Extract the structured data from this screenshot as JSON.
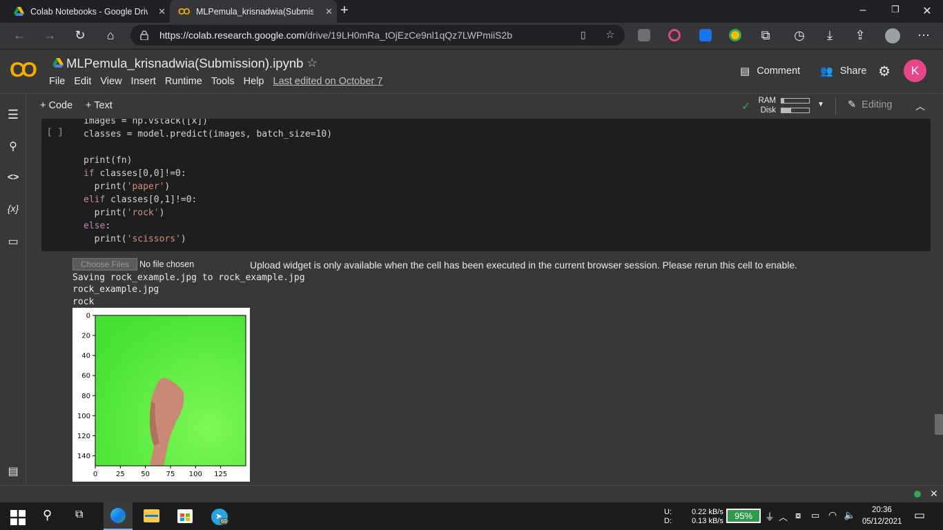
{
  "browser": {
    "tabs": [
      {
        "title": "Colab Notebooks - Google Drive"
      },
      {
        "title": "MLPemula_krisnadwia(Submission)"
      }
    ],
    "url_host": "https://colab.research.google.com",
    "url_path": "/drive/19LH0mRa_tOjEzCe9nl1qQz7LWPmiiS2b"
  },
  "colab": {
    "logo": "CO",
    "title": "MLPemula_krisnadwia(Submission).ipynb",
    "menu": [
      "File",
      "Edit",
      "View",
      "Insert",
      "Runtime",
      "Tools",
      "Help"
    ],
    "last_edited": "Last edited on October 7",
    "comment": "Comment",
    "share": "Share",
    "avatar": "K",
    "add_code": "+ Code",
    "add_text": "+ Text",
    "ram": "RAM",
    "disk": "Disk",
    "editing": "Editing"
  },
  "cell": {
    "run_indicator": "[ ]",
    "code_lines": [
      "images = np.vstack([x])",
      "classes = model.predict(images, batch_size=10)",
      "",
      "print(fn)",
      "if classes[0,0]!=0:",
      "  print('paper')",
      "elif classes[0,1]!=0:",
      "  print('rock')",
      "else:",
      "  print('scissors')"
    ]
  },
  "output": {
    "choose_files": "Choose Files",
    "no_file": "No file chosen",
    "upload_msg": "Upload widget is only available when the cell has been executed in the current browser session. Please rerun this cell to enable.",
    "lines": [
      "Saving rock_example.jpg to rock_example.jpg",
      "rock_example.jpg",
      "rock"
    ]
  },
  "chart_data": {
    "type": "image",
    "x_ticks": [
      "0",
      "25",
      "50",
      "75",
      "100",
      "125"
    ],
    "y_ticks": [
      "0",
      "20",
      "40",
      "60",
      "80",
      "100",
      "120",
      "140"
    ],
    "xlim": [
      0,
      150
    ],
    "ylim": [
      150,
      0
    ],
    "background_color": "#4ee83a"
  },
  "taskbar": {
    "net_up_label": "U:",
    "net_down_label": "D:",
    "net_up": "0.22 kB/s",
    "net_down": "0.13 kB/s",
    "battery": "95%",
    "time": "20:36",
    "date": "05/12/2021",
    "telegram_badge": "69"
  }
}
